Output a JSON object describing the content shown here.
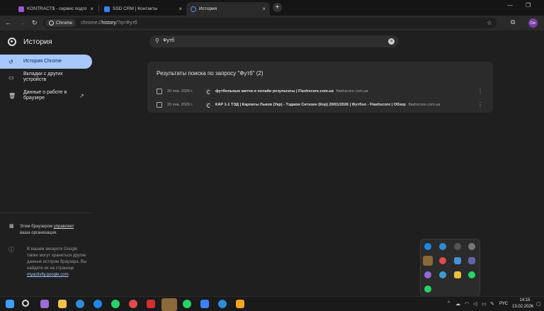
{
  "tabs": [
    {
      "title": "KONTRACT$ - сервис подготов",
      "favicon_color": "#9b59d0",
      "active": false
    },
    {
      "title": "SSD CRM | Контакты",
      "favicon_color": "#3b82f6",
      "active": false
    },
    {
      "title": "История",
      "favicon_color": "#5b8def",
      "active": true
    }
  ],
  "toolbar": {
    "chip_label": "Chrome",
    "url_prefix": "chrome://",
    "url_host": "history",
    "url_suffix": "/?q=Футб",
    "profile_initials": "De"
  },
  "sidebar": {
    "title": "История",
    "items": [
      {
        "label": "История Chrome",
        "icon": "history-icon"
      },
      {
        "label": "Вкладки с других устройств",
        "icon": "devices-icon"
      },
      {
        "label": "Данные о работе в браузере",
        "icon": "trash-icon",
        "trailing_icon": "open-external-icon"
      }
    ],
    "managed_text_1": "Этим браузером",
    "managed_link": "управляет",
    "managed_text_2": "ваша организация.",
    "google_note": "В вашем аккаунте Google также могут храниться другие данные истории браузера. Вы найдете их на странице",
    "google_link": "myactivity.google.com",
    "google_note_end": "."
  },
  "search": {
    "value": "Футб"
  },
  "results": {
    "heading": "Результаты поиска по запросу \"Футб\" (2)",
    "rows": [
      {
        "date": "20 янв. 2026 г.",
        "title_bold": "футб",
        "title_rest": "ольные матчи и онлайн результаты | Flashscore.com.ua",
        "domain": "flashscore.com.ua"
      },
      {
        "date": "20 янв. 2026 г.",
        "title_bold": "",
        "title_rest": "КАР 1-1 ТЭД | Карпаты Львов (Укр) - Тэджон Ситизен (Кор) 20/01/2026 | Футбол - Flashscore | Обзор",
        "domain": "flashscore.com.ua"
      }
    ]
  },
  "taskbar": {
    "lang": "РУС",
    "time": "14:15",
    "date": "13.02.2026"
  },
  "colors": {
    "accent": "#a8c7fa",
    "background": "#1f1f1f",
    "card": "#2b2b2b"
  }
}
